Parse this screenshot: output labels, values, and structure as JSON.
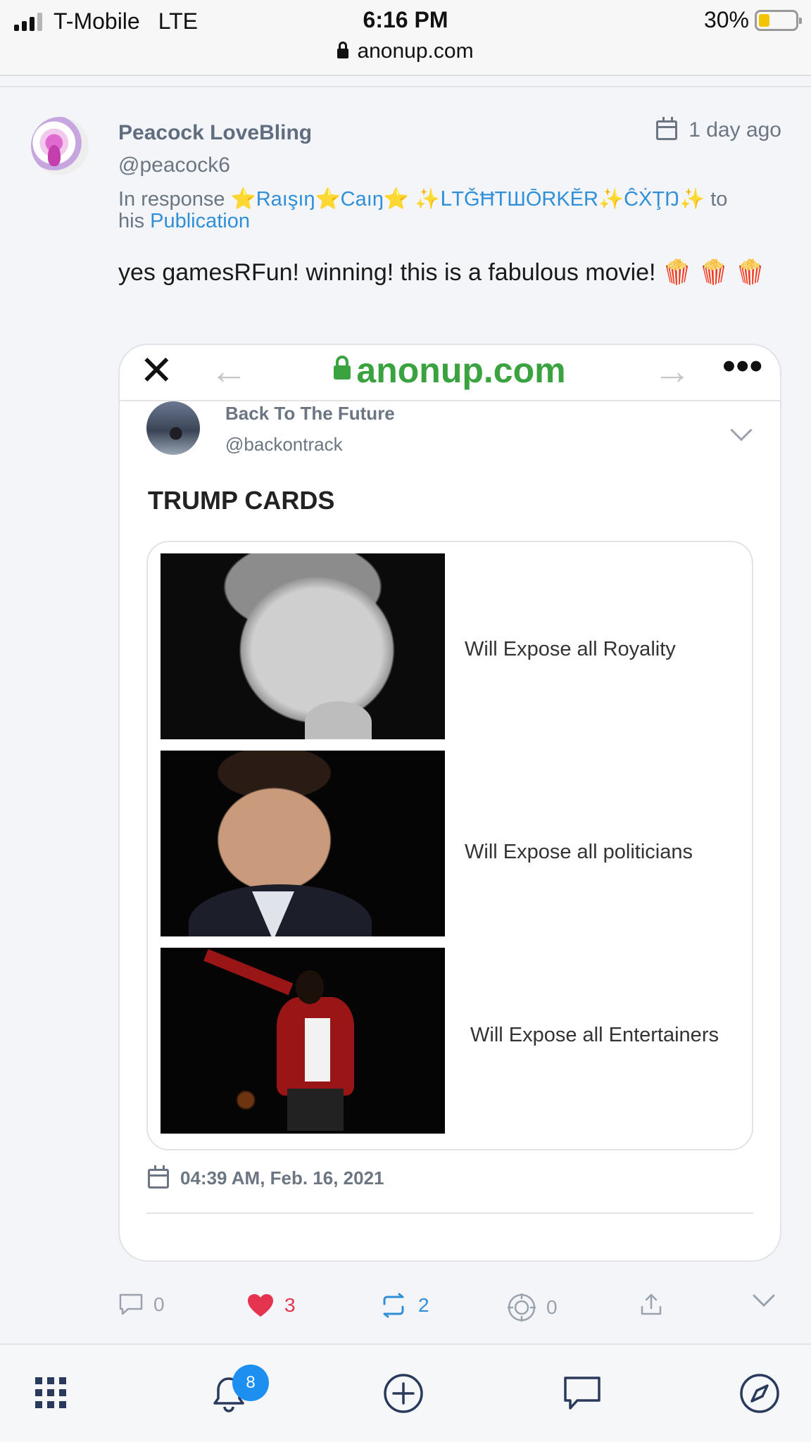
{
  "status_bar": {
    "carrier": "T-Mobile",
    "network": "LTE",
    "time": "6:16 PM",
    "battery_percent": "30%",
    "battery_level": 0.3,
    "url": "anonup.com"
  },
  "post": {
    "author_name": "Peacock LoveBling",
    "author_handle": "@peacock6",
    "time_ago": "1 day ago",
    "in_response_prefix": "In response",
    "in_response_users": "⭐Raışıŋ⭐Caıŋ⭐ ✨ᒪTǦĦTШŌRKĔR✨ĈẊŢŊ✨",
    "in_response_to": "to",
    "in_response_his": "his",
    "publication_link": "Publication",
    "text": "yes gamesRFun! winning! this is a fabulous movie! 🍿 🍿 🍿"
  },
  "embedded": {
    "close": "✕",
    "back": "←",
    "forward": "→",
    "more": "•••",
    "url": "anonup.com",
    "author_name": "Back To The Future",
    "author_handle": "@backontrack",
    "title": "TRUMP CARDS",
    "captions": [
      "Will Expose all Royality",
      "Will Expose all politicians",
      "Will Expose all Entertainers"
    ],
    "date": "04:39 AM, Feb. 16, 2021"
  },
  "actions": {
    "comments": "0",
    "likes": "3",
    "reposts": "2",
    "tips": "0"
  },
  "bottom_nav": {
    "notification_count": "8",
    "items": [
      "apps-grid-icon",
      "bell-icon",
      "plus-circle-icon",
      "chat-icon",
      "compass-icon"
    ]
  },
  "colors": {
    "accent": "#2f8fd8",
    "like": "#e5344f",
    "url_green": "#3aa33f",
    "badge": "#1d8ff0"
  }
}
